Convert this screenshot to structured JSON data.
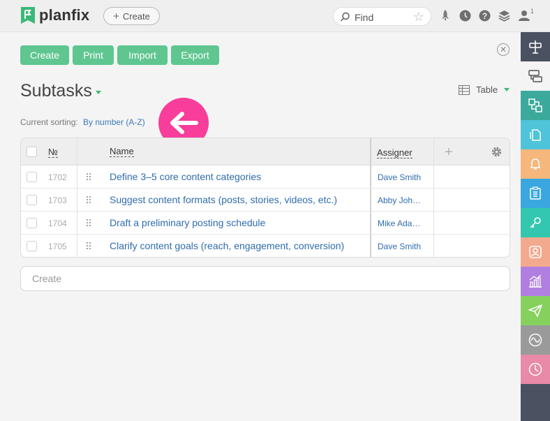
{
  "app": {
    "name": "planfix"
  },
  "topbar": {
    "create_label": "Create",
    "search_placeholder": "Find",
    "notification_count": "1"
  },
  "toolbar": {
    "buttons": [
      "Create",
      "Print",
      "Import",
      "Export"
    ]
  },
  "page": {
    "title": "Subtasks",
    "view_label": "Table",
    "sorting_label": "Current sorting:",
    "sorting_value": "By number (A-Z)"
  },
  "table": {
    "columns": {
      "number": "№",
      "name": "Name",
      "assigner": "Assigner"
    },
    "rows": [
      {
        "number": "1702",
        "name": "Define 3–5 core content categories",
        "assigner": "Dave Smith"
      },
      {
        "number": "1703",
        "name": "Suggest content formats (posts, stories, videos, etc.)",
        "assigner": "Abby Joh…"
      },
      {
        "number": "1704",
        "name": "Draft a preliminary posting schedule",
        "assigner": "Mike Ada…"
      },
      {
        "number": "1705",
        "name": "Clarify content goals (reach, engagement, conversion)",
        "assigner": "Dave Smith"
      }
    ]
  },
  "create_input": {
    "placeholder": "Create"
  },
  "colors": {
    "accent_green": "#5fc690",
    "link_blue": "#2f6cad",
    "highlight_pink": "#f83d9a",
    "sidebar_bg": "#4a5160"
  },
  "sidebar": {
    "items": [
      {
        "icon": "signpost-icon",
        "color": "#4a5160"
      },
      {
        "icon": "subtasks-icon",
        "color": "#f4f4f4"
      },
      {
        "icon": "process-icon",
        "color": "#3ba99c"
      },
      {
        "icon": "files-icon",
        "color": "#4fc3d9"
      },
      {
        "icon": "bell-icon",
        "color": "#f5b77c"
      },
      {
        "icon": "checklist-icon",
        "color": "#3aa7e0"
      },
      {
        "icon": "key-icon",
        "color": "#33c7b0"
      },
      {
        "icon": "contact-icon",
        "color": "#f3a98e"
      },
      {
        "icon": "chart-icon",
        "color": "#b17fe0"
      },
      {
        "icon": "send-icon",
        "color": "#86d15e"
      },
      {
        "icon": "wave-icon",
        "color": "#9a9a9a"
      },
      {
        "icon": "clock-icon",
        "color": "#e88aa8"
      }
    ]
  }
}
